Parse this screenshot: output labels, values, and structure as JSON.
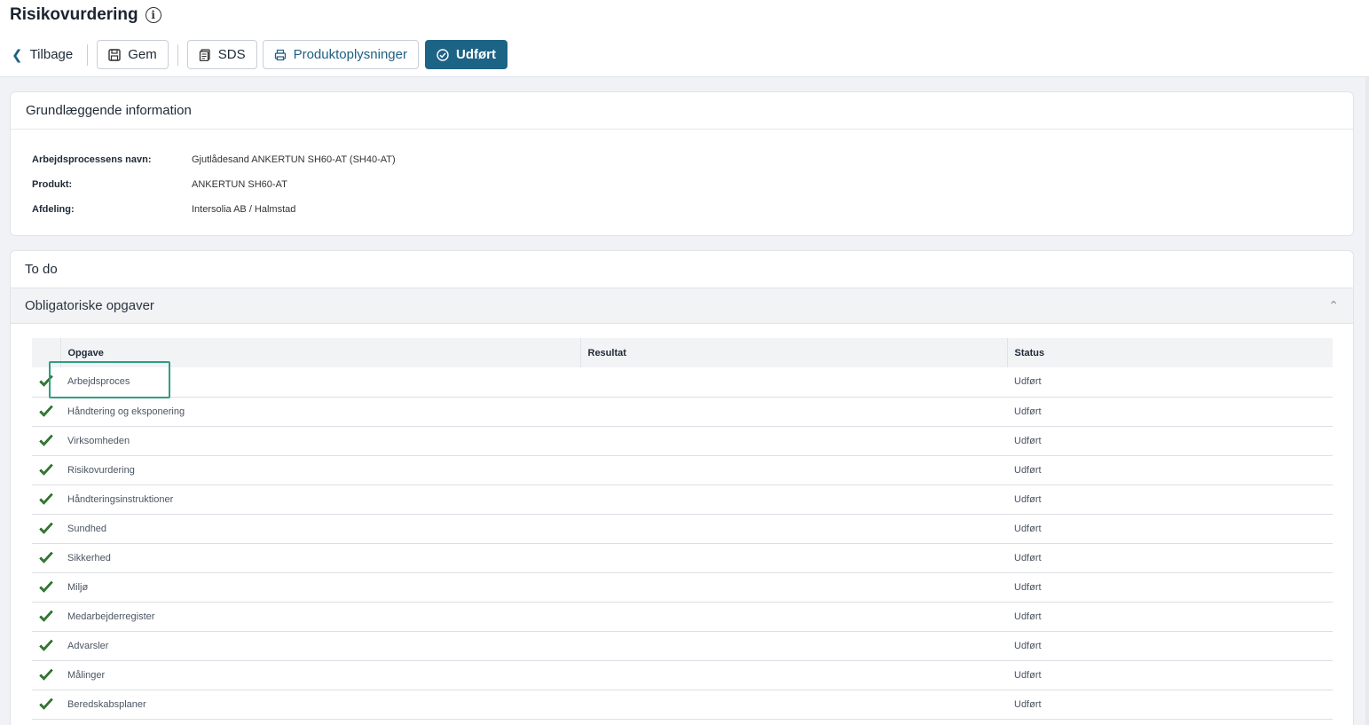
{
  "page": {
    "title": "Risikovurdering"
  },
  "toolbar": {
    "back_label": "Tilbage",
    "save_label": "Gem",
    "sds_label": "SDS",
    "product_info_label": "Produktoplysninger",
    "done_label": "Udført"
  },
  "basic_info": {
    "title": "Grundlæggende information",
    "rows": [
      {
        "label": "Arbejdsprocessens navn:",
        "value": "Gjutlådesand ANKERTUN SH60-AT (SH40-AT)"
      },
      {
        "label": "Produkt:",
        "value": "ANKERTUN SH60-AT"
      },
      {
        "label": "Afdeling:",
        "value": "Intersolia AB / Halmstad"
      }
    ]
  },
  "todo": {
    "title": "To do",
    "section_title": "Obligatoriske opgaver",
    "columns": {
      "task": "Opgave",
      "result": "Resultat",
      "status": "Status"
    },
    "rows": [
      {
        "task": "Arbejdsproces",
        "result": "",
        "status": "Udført"
      },
      {
        "task": "Håndtering og eksponering",
        "result": "",
        "status": "Udført"
      },
      {
        "task": "Virksomheden",
        "result": "",
        "status": "Udført"
      },
      {
        "task": "Risikovurdering",
        "result": "",
        "status": "Udført"
      },
      {
        "task": "Håndteringsinstruktioner",
        "result": "",
        "status": "Udført"
      },
      {
        "task": "Sundhed",
        "result": "",
        "status": "Udført"
      },
      {
        "task": "Sikkerhed",
        "result": "",
        "status": "Udført"
      },
      {
        "task": "Miljø",
        "result": "",
        "status": "Udført"
      },
      {
        "task": "Medarbejderregister",
        "result": "",
        "status": "Udført"
      },
      {
        "task": "Advarsler",
        "result": "",
        "status": "Udført"
      },
      {
        "task": "Målinger",
        "result": "",
        "status": "Udført"
      },
      {
        "task": "Beredskabsplaner",
        "result": "",
        "status": "Udført"
      }
    ]
  },
  "colors": {
    "primary": "#1d6386",
    "check_green": "#2e8b2e",
    "highlight": "#2e9e83"
  },
  "icons": {
    "info": "info-icon",
    "back": "chevron-left-icon",
    "save": "save-icon",
    "sds": "document-icon",
    "product": "printer-icon",
    "done": "check-circle-icon",
    "row_check": "checkmark-icon",
    "collapse": "chevron-up-icon"
  }
}
